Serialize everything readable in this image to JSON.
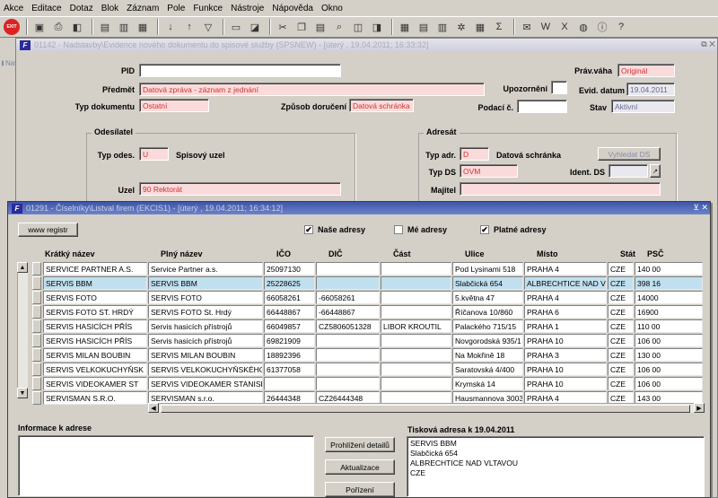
{
  "menu": [
    "Akce",
    "Editace",
    "Dotaz",
    "Blok",
    "Záznam",
    "Pole",
    "Funkce",
    "Nástroje",
    "Nápověda",
    "Okno"
  ],
  "toolbar": {
    "exit_label": "EXIT"
  },
  "win1": {
    "title": "01142 - Nadstavby\\Evidence nového dokumentu do spisové služby (SPSNEW) - [úterý , 19.04.2011; 16:33:32]",
    "nav": "Nav",
    "labels": {
      "pid": "PID",
      "predmet": "Předmět",
      "typ_dok": "Typ dokumentu",
      "zpusob": "Způsob doručení",
      "prav_vaha": "Práv.váha",
      "upozorneni": "Upozornění",
      "evid_datum": "Evid. datum",
      "podaci": "Podací č.",
      "stav": "Stav"
    },
    "values": {
      "pid": "",
      "predmet": "Datová zpráva - záznam z jednání",
      "typ_dok": "Ostatní",
      "zpusob": "Datová schránka",
      "prav_vaha": "Originál",
      "upozorneni": "",
      "evid_datum": "19.04.2011",
      "podaci": "",
      "stav": "Aktivní"
    },
    "odesilatel": {
      "title": "Odesílatel",
      "typ_label": "Typ odes.",
      "typ_value": "U",
      "typ_text": "Spisový uzel",
      "uzel_label": "Uzel",
      "uzel_value": "90 Rektorát"
    },
    "adresat": {
      "title": "Adresát",
      "typ_label": "Typ adr.",
      "typ_value": "D",
      "typ_text": "Datová schránka",
      "vyhledat": "Vyhledat DS",
      "typds_label": "Typ DS",
      "typds_value": "OVM",
      "ident_label": "Ident. DS",
      "ident_value": "",
      "majitel_label": "Majitel",
      "majitel_value": ""
    }
  },
  "win2": {
    "title": "01291 - Číselníky\\Listval firem (EKCIS1) - [úterý , 19.04.2011; 16:34:12]",
    "registr_btn": "www registr",
    "checks": [
      {
        "label": "Naše adresy",
        "checked": "✔"
      },
      {
        "label": "Mé adresy",
        "checked": ""
      },
      {
        "label": "Platné adresy",
        "checked": "✔"
      }
    ],
    "columns": [
      "Krátký název",
      "Plný název",
      "IČO",
      "DIČ",
      "Část",
      "Ulice",
      "Místo",
      "Stát",
      "PSČ"
    ],
    "rows": [
      [
        "SERVICE PARTNER A.S.",
        "Service Partner a.s.",
        "25097130",
        "",
        "",
        "Pod Lysinami 518",
        "PRAHA 4",
        "CZE",
        "140 00"
      ],
      [
        "SERVIS BBM",
        "SERVIS BBM",
        "25228625",
        "",
        "",
        "Slabčická 654",
        "ALBRECHTICE NAD VLT",
        "CZE",
        "398 16"
      ],
      [
        "SERVIS FOTO",
        "SERVIS FOTO",
        "66058261",
        "-66058261",
        "",
        "5.května 47",
        "PRAHA 4",
        "CZE",
        "14000"
      ],
      [
        "SERVIS FOTO ST. HRDÝ",
        "SERVIS FOTO St. Hrdý",
        "66448867",
        "-66448867",
        "",
        "Říčanova 10/860",
        "PRAHA 6",
        "CZE",
        "16900"
      ],
      [
        "SERVIS HASICÍCH PŘÍS",
        "Servis hasicích přístrojů",
        "66049857",
        "CZ5806051328",
        "LIBOR KROUTIL",
        "Palackého 715/15",
        "PRAHA 1",
        "CZE",
        "110 00"
      ],
      [
        "SERVIS HASICÍCH PŘÍS",
        "Servis hasicích přístrojů",
        "69821909",
        "",
        "",
        "Novgorodská 935/1",
        "PRAHA 10",
        "CZE",
        "106 00"
      ],
      [
        "SERVIS MILAN BOUBIN",
        "SERVIS MILAN BOUBIN",
        "18892396",
        "",
        "",
        "Na Mokřině 18",
        "PRAHA 3",
        "CZE",
        "130 00"
      ],
      [
        "SERVIS VELKOKUCHYŇSK",
        "SERVIS VELKOKUCHYŇSKÉHO",
        "61377058",
        "",
        "",
        "Saratovská 4/400",
        "PRAHA 10",
        "CZE",
        "106 00"
      ],
      [
        "SERVIS VIDEOKAMER ST",
        "SERVIS VIDEOKAMER STANISLA",
        "",
        "",
        "",
        "Krymská 14",
        "PRAHA 10",
        "CZE",
        "106 00"
      ],
      [
        "SERVISMAN S.R.O.",
        "SERVISMAN s.r.o.",
        "26444348",
        "CZ26444348",
        "",
        "Hausmannova 3003",
        "PRAHA 4",
        "CZE",
        "143 00"
      ]
    ],
    "info_label": "Informace k adrese",
    "btn_prohlizeni": "Prohlížení detailů",
    "btn_aktualizace": "Aktualizace",
    "btn_porizeni": "Pořízení",
    "tisk_label": "Tisková adresa k 19.04.2011",
    "tisk_lines": [
      "SERVIS BBM",
      "Slabčická 654",
      "ALBRECHTICE NAD VLTAVOU",
      "CZE"
    ]
  }
}
